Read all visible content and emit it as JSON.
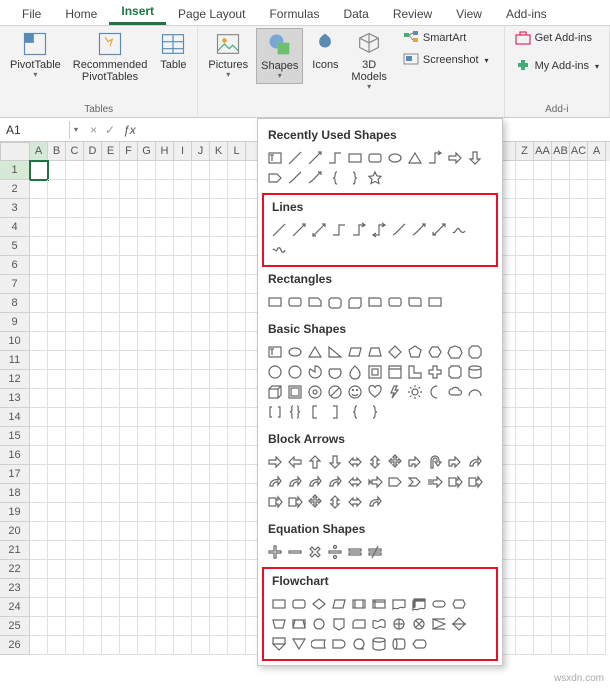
{
  "tabs": [
    "File",
    "Home",
    "Insert",
    "Page Layout",
    "Formulas",
    "Data",
    "Review",
    "View",
    "Add-ins"
  ],
  "active_tab": "Insert",
  "ribbon": {
    "tables": {
      "pivottable": "PivotTable",
      "recommended": "Recommended\nPivotTables",
      "table": "Table",
      "label": "Tables"
    },
    "illus": {
      "pictures": "Pictures",
      "shapes": "Shapes",
      "icons": "Icons",
      "models": "3D\nModels"
    },
    "extras": {
      "smartart": "SmartArt",
      "screenshot": "Screenshot"
    },
    "addins": {
      "get": "Get Add-ins",
      "my": "My Add-ins",
      "label": "Add-i"
    }
  },
  "namebox": "A1",
  "columns": [
    "A",
    "B",
    "C",
    "D",
    "E",
    "F",
    "G",
    "H",
    "I",
    "J",
    "K",
    "L",
    "",
    "",
    "",
    "",
    "",
    "",
    "",
    "",
    "",
    "",
    "",
    "",
    "",
    "",
    "",
    "Z",
    "AA",
    "AB",
    "AC",
    "A"
  ],
  "rows": [
    "1",
    "2",
    "3",
    "4",
    "5",
    "6",
    "7",
    "8",
    "9",
    "10",
    "11",
    "12",
    "13",
    "14",
    "15",
    "16",
    "17",
    "18",
    "19",
    "20",
    "21",
    "22",
    "23",
    "24",
    "25",
    "26"
  ],
  "shapes_panel": {
    "recently": "Recently Used Shapes",
    "lines": "Lines",
    "rectangles": "Rectangles",
    "basic": "Basic Shapes",
    "block": "Block Arrows",
    "equation": "Equation Shapes",
    "flowchart": "Flowchart"
  },
  "watermark": "wsxdn.com"
}
